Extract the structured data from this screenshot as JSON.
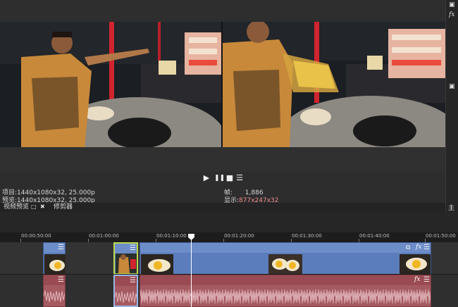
{
  "preview": {
    "project_label": "项目:",
    "project_value": "1440x1080x32, 25.000p",
    "preview_label": "预览:",
    "preview_value": "1440x1080x32, 25.000p",
    "frame_label": "帧:",
    "frame_value": "1,886",
    "display_label": "显示:",
    "display_value": "877x247x32"
  },
  "transport": {
    "play_glyph": "▶",
    "pause_glyph": "❚❚",
    "stop_glyph": "■",
    "menu_glyph": "☰"
  },
  "tabs": {
    "video_preview": "视频预览",
    "restore_glyph": "□",
    "close_glyph": "✖",
    "trimmer": "修剪器"
  },
  "right_panel": {
    "top_glyph": "▣",
    "fx_glyph": "fx",
    "mid_glyph": "▣",
    "label": "主"
  },
  "ruler": {
    "ticks": [
      "00:00:50:00",
      "00:01:00:00",
      "00:01:10:00",
      "00:01:20:00",
      "00:01:30:00",
      "00:01:40:00",
      "00:01:50:00"
    ]
  },
  "timeline": {
    "menu_glyph": "☰",
    "fx_glyph": "fx",
    "crop_glyph": "⧉"
  },
  "colors": {
    "video_clip": "#5b7dbb",
    "audio_clip": "#a55a62",
    "display_value": "#f08a8a",
    "selected_clip_border": "#b8d84a"
  }
}
